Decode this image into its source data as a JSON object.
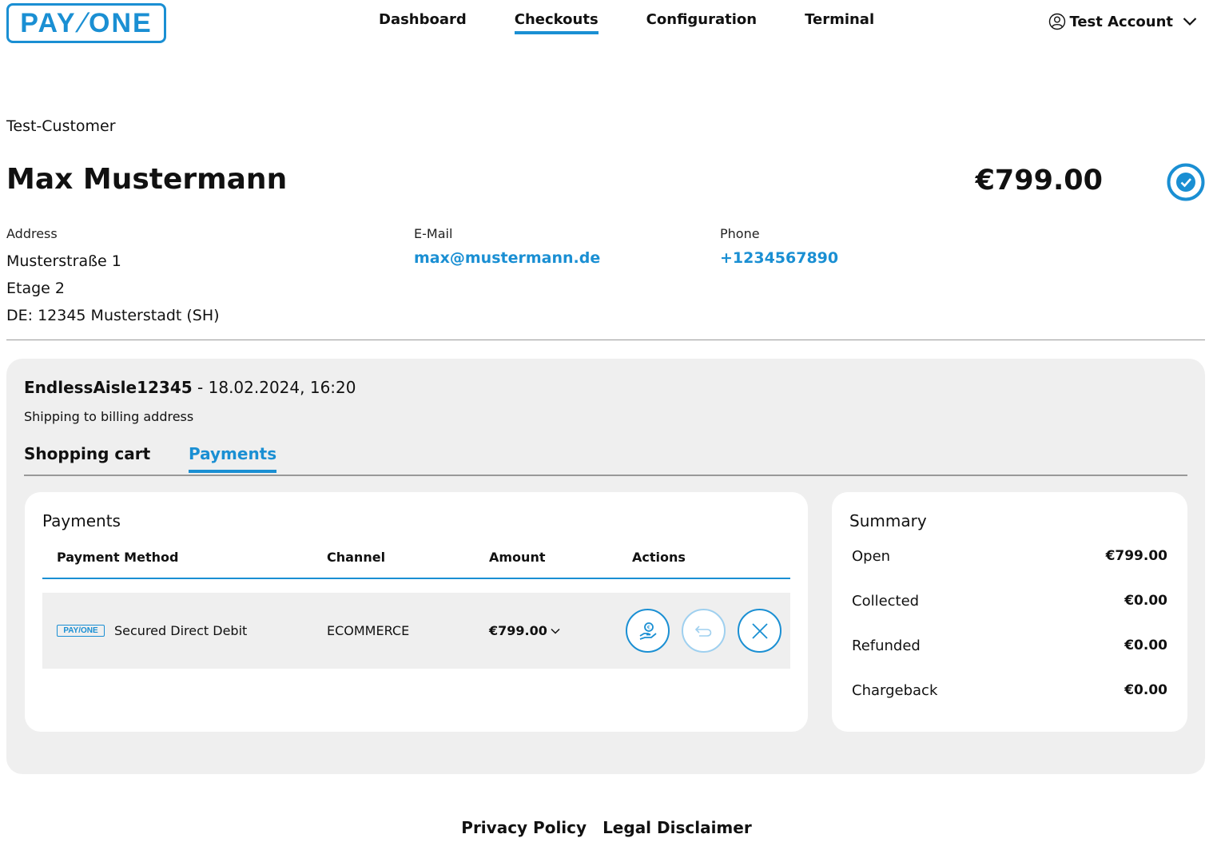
{
  "brand": {
    "logo_left": "PAY",
    "logo_slash": "/",
    "logo_right": "ONE",
    "accent_color": "#1a8fd3"
  },
  "nav": {
    "items": [
      {
        "label": "Dashboard",
        "active": false
      },
      {
        "label": "Checkouts",
        "active": true
      },
      {
        "label": "Configuration",
        "active": false
      },
      {
        "label": "Terminal",
        "active": false
      }
    ]
  },
  "account": {
    "label": "Test Account",
    "icon": "user-circle-icon"
  },
  "customer": {
    "type_label": "Test-Customer",
    "name": "Max Mustermann",
    "total": "€799.00",
    "status_icon": "check-circle-icon",
    "address": {
      "label": "Address",
      "line1": "Musterstraße 1",
      "line2": "Etage 2",
      "line3": "DE: 12345 Musterstadt (SH)"
    },
    "email": {
      "label": "E-Mail",
      "value": "max@mustermann.de"
    },
    "phone": {
      "label": "Phone",
      "value": "+1234567890"
    }
  },
  "order": {
    "reference": "EndlessAisle12345",
    "datetime": " - 18.02.2024, 16:20",
    "shipping": "Shipping to billing address",
    "tabs": [
      {
        "label": "Shopping cart",
        "active": false
      },
      {
        "label": "Payments",
        "active": true
      }
    ]
  },
  "payments": {
    "title": "Payments",
    "columns": [
      "Payment Method",
      "Channel",
      "Amount",
      "Actions"
    ],
    "rows": [
      {
        "method_logo": "PAY/ONE",
        "method": "Secured Direct Debit",
        "channel": "ECOMMERCE",
        "amount": "€799.00",
        "actions": [
          "capture-icon",
          "refund-icon",
          "cancel-icon"
        ]
      }
    ]
  },
  "summary": {
    "title": "Summary",
    "items": [
      {
        "label": "Open",
        "value": "€799.00"
      },
      {
        "label": "Collected",
        "value": "€0.00"
      },
      {
        "label": "Refunded",
        "value": "€0.00"
      },
      {
        "label": "Chargeback",
        "value": "€0.00"
      }
    ]
  },
  "footer": {
    "privacy": "Privacy Policy",
    "legal": "Legal Disclaimer"
  }
}
